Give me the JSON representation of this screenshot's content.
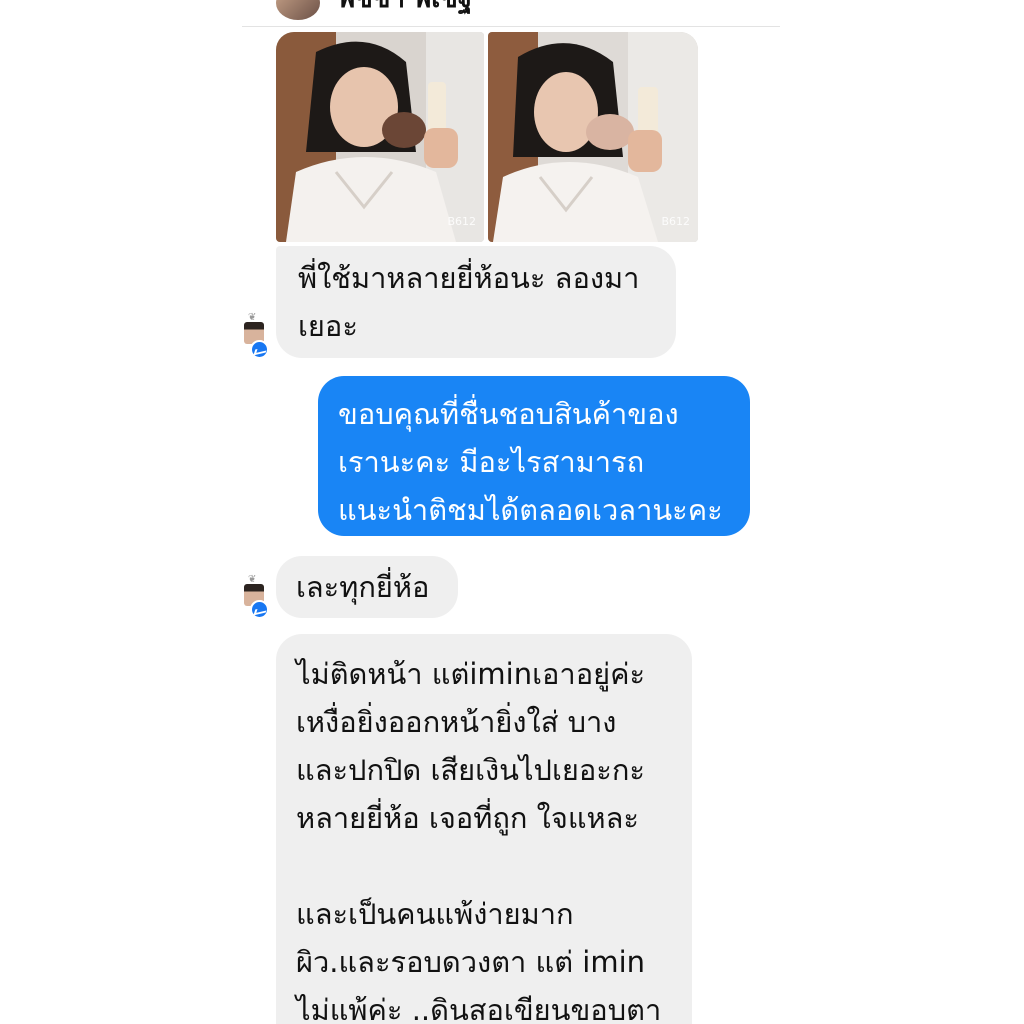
{
  "header": {
    "contact_name": "พิชชา พิเชฐ",
    "avatar_icon": "profile-photo"
  },
  "photos": [
    {
      "name": "selfie-with-product-1",
      "watermark": "B612"
    },
    {
      "name": "selfie-with-product-2",
      "watermark": "B612"
    }
  ],
  "messages": [
    {
      "direction": "incoming",
      "text": "พี่ใช้มาหลายยี่ห้อนะ ลองมา\nเยอะ"
    },
    {
      "direction": "outgoing",
      "text": "ขอบคุณที่ชื่นชอบสินค้าของ\nเรานะคะ มีอะไรสามารถ\nแนะนำติชมได้ตลอดเวลานะคะ"
    },
    {
      "direction": "incoming",
      "text": "เละทุกยี่ห้อ"
    },
    {
      "direction": "incoming",
      "text": "ไม่ติดหน้า แต่iminเอาอยู่ค่ะ\nเหงื่อยิ่งออกหน้ายิ่งใส่ บาง\nและปกปิด เสียเงินไปเยอะกะ\nหลายยี่ห้อ เจอที่ถูก ใจแหละ\n\nและเป็นคนแพ้ง่ายมาก\nผิว.และรอบดวงตา แต่ imin\nไม่แพ้ค่ะ ..ดินสอเขียนขอบตา"
    }
  ],
  "colors": {
    "outgoing_bubble": "#1985f5",
    "incoming_bubble": "#efefef",
    "messenger_badge": "#1877f2"
  }
}
